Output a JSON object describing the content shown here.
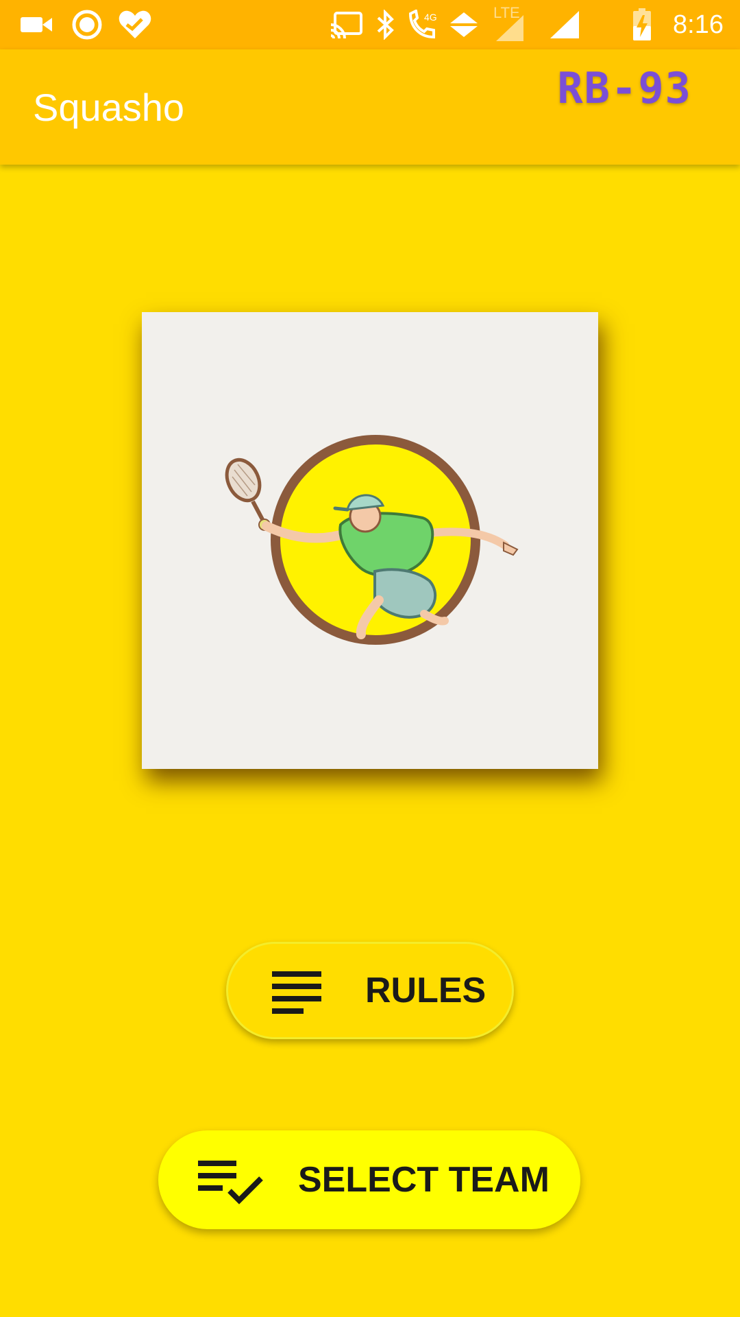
{
  "status_bar": {
    "time": "8:16",
    "network_label": "4G",
    "lte_label": "LTE",
    "icons": [
      "video-camera-icon",
      "circle-notification-icon",
      "heart-check-icon",
      "cast-icon",
      "bluetooth-icon",
      "wifi-calling-icon",
      "data-arrows-icon",
      "signal-lte-icon",
      "signal-icon",
      "battery-charging-icon"
    ]
  },
  "app_bar": {
    "title": "Squasho",
    "tag": "RB-93"
  },
  "logo": {
    "icon": "tennis-player-logo",
    "colors": {
      "ring": "#8B5A3C",
      "circle_fill": "#FFF200",
      "shirt": "#6FD36A",
      "card": "#F2F0EC"
    }
  },
  "buttons": {
    "rules": {
      "label": "RULES",
      "icon": "notes-lines-icon"
    },
    "select_team": {
      "label": "SELECT TEAM",
      "icon": "playlist-check-icon"
    }
  },
  "colors": {
    "background": "#FFDD00",
    "app_bar": "#FFC800",
    "status_bar": "#FFB300",
    "select_team_button": "#FFFF00",
    "tag_text": "#7B4FD6"
  }
}
